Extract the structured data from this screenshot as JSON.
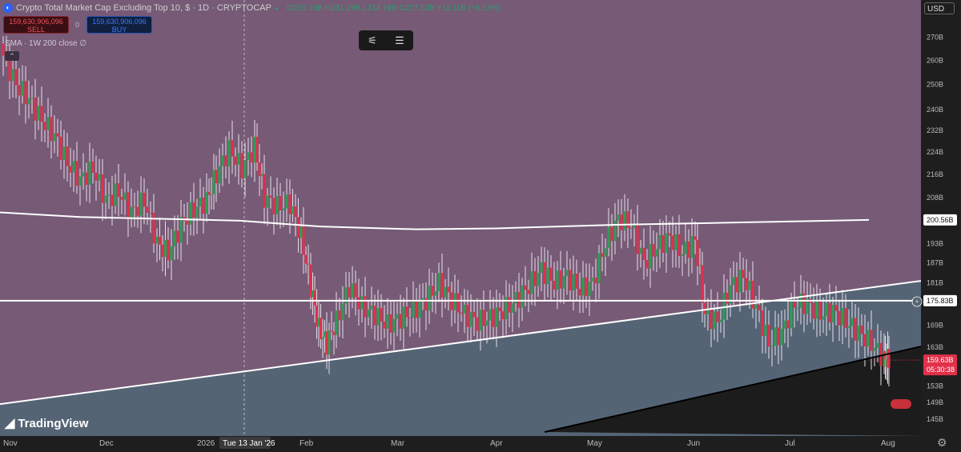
{
  "header": {
    "title": "Crypto Total Market Cap Excluding Top 10, $ · 1D · CRYPTOCAP",
    "ohlc": {
      "open": "O216.15B",
      "high": "H231.19B",
      "low": "L214.19B",
      "close": "C227.52B",
      "change": "+11.11B (+5.13%)"
    },
    "sell_price": "159,630,906,096",
    "sell_label": "SELL",
    "buy_price": "159,630,906,096",
    "buy_label": "BUY",
    "spread": "0",
    "indicator": "SMA · 1W 200 close ∅",
    "currency": "USD",
    "brand": "TradingView"
  },
  "chart_data": {
    "type": "candlestick",
    "title": "Crypto Total Market Cap Excluding Top 10, $ · 1D · CRYPTOCAP",
    "ylabel": "USD",
    "y_scale": "log",
    "ylim": [
      142,
      285
    ],
    "y_ticks": [
      "270B",
      "260B",
      "250B",
      "240B",
      "232B",
      "224B",
      "216B",
      "208B",
      "200.56B",
      "193B",
      "187B",
      "181B",
      "175.83B",
      "169B",
      "163B",
      "159.63B",
      "153B",
      "149B",
      "145B"
    ],
    "x_ticks": [
      "Nov",
      "Dec",
      "2026",
      "Tue 13 Jan '26",
      "Feb",
      "Mar",
      "Apr",
      "May",
      "Jun",
      "Jul",
      "Aug"
    ],
    "crosshair_date": "Tue 13 Jan '26",
    "last_price": "159.63B",
    "countdown": "05:30:38",
    "sma_label": "200.56B",
    "hline_label": "175.83B",
    "colors": {
      "up": "#2e9e52",
      "down": "#e0304a",
      "bg_upper": "#765a76",
      "bg_lower": "#556475",
      "grid": "#8a7590"
    },
    "sma_1w_200": [
      [
        0,
        203
      ],
      [
        100,
        201.5
      ],
      [
        200,
        200.9
      ],
      [
        300,
        200.3
      ],
      [
        400,
        198.4
      ],
      [
        520,
        197.5
      ],
      [
        620,
        197.8
      ],
      [
        760,
        198.9
      ],
      [
        900,
        199.6
      ],
      [
        1085,
        200.56
      ]
    ],
    "horizontal_line": 175.83,
    "support_trendline": [
      [
        0,
        148.6
      ],
      [
        1150,
        181.6
      ]
    ],
    "lower_trendline": [
      [
        680,
        142
      ],
      [
        1150,
        163.2
      ]
    ],
    "close_series": [
      {
        "x": 4,
        "v": 262
      },
      {
        "x": 20,
        "v": 250
      },
      {
        "x": 36,
        "v": 244
      },
      {
        "x": 52,
        "v": 236
      },
      {
        "x": 68,
        "v": 230
      },
      {
        "x": 84,
        "v": 220
      },
      {
        "x": 100,
        "v": 214
      },
      {
        "x": 116,
        "v": 218
      },
      {
        "x": 132,
        "v": 207
      },
      {
        "x": 148,
        "v": 210
      },
      {
        "x": 164,
        "v": 203
      },
      {
        "x": 180,
        "v": 207
      },
      {
        "x": 196,
        "v": 193
      },
      {
        "x": 210,
        "v": 190
      },
      {
        "x": 226,
        "v": 199
      },
      {
        "x": 242,
        "v": 204
      },
      {
        "x": 258,
        "v": 207
      },
      {
        "x": 270,
        "v": 216
      },
      {
        "x": 286,
        "v": 225
      },
      {
        "x": 302,
        "v": 218
      },
      {
        "x": 318,
        "v": 226
      },
      {
        "x": 330,
        "v": 208
      },
      {
        "x": 346,
        "v": 205
      },
      {
        "x": 362,
        "v": 206
      },
      {
        "x": 376,
        "v": 195
      },
      {
        "x": 388,
        "v": 180
      },
      {
        "x": 398,
        "v": 168
      },
      {
        "x": 408,
        "v": 164
      },
      {
        "x": 420,
        "v": 170
      },
      {
        "x": 436,
        "v": 180
      },
      {
        "x": 452,
        "v": 174
      },
      {
        "x": 468,
        "v": 172
      },
      {
        "x": 484,
        "v": 169
      },
      {
        "x": 500,
        "v": 171
      },
      {
        "x": 516,
        "v": 173
      },
      {
        "x": 532,
        "v": 176
      },
      {
        "x": 548,
        "v": 181
      },
      {
        "x": 564,
        "v": 176
      },
      {
        "x": 580,
        "v": 172
      },
      {
        "x": 596,
        "v": 170
      },
      {
        "x": 612,
        "v": 171
      },
      {
        "x": 628,
        "v": 173
      },
      {
        "x": 644,
        "v": 176
      },
      {
        "x": 660,
        "v": 180
      },
      {
        "x": 676,
        "v": 185
      },
      {
        "x": 692,
        "v": 181
      },
      {
        "x": 708,
        "v": 183
      },
      {
        "x": 724,
        "v": 179
      },
      {
        "x": 740,
        "v": 181
      },
      {
        "x": 756,
        "v": 193
      },
      {
        "x": 772,
        "v": 201
      },
      {
        "x": 788,
        "v": 199
      },
      {
        "x": 804,
        "v": 187
      },
      {
        "x": 820,
        "v": 192
      },
      {
        "x": 836,
        "v": 195
      },
      {
        "x": 852,
        "v": 190
      },
      {
        "x": 868,
        "v": 194
      },
      {
        "x": 880,
        "v": 172
      },
      {
        "x": 896,
        "v": 170
      },
      {
        "x": 912,
        "v": 180
      },
      {
        "x": 928,
        "v": 183
      },
      {
        "x": 944,
        "v": 174
      },
      {
        "x": 960,
        "v": 164
      },
      {
        "x": 976,
        "v": 167
      },
      {
        "x": 992,
        "v": 175
      },
      {
        "x": 1008,
        "v": 175
      },
      {
        "x": 1024,
        "v": 172
      },
      {
        "x": 1040,
        "v": 173
      },
      {
        "x": 1056,
        "v": 170
      },
      {
        "x": 1072,
        "v": 167
      },
      {
        "x": 1088,
        "v": 164
      },
      {
        "x": 1104,
        "v": 160
      },
      {
        "x": 1110,
        "v": 159.63
      }
    ]
  }
}
